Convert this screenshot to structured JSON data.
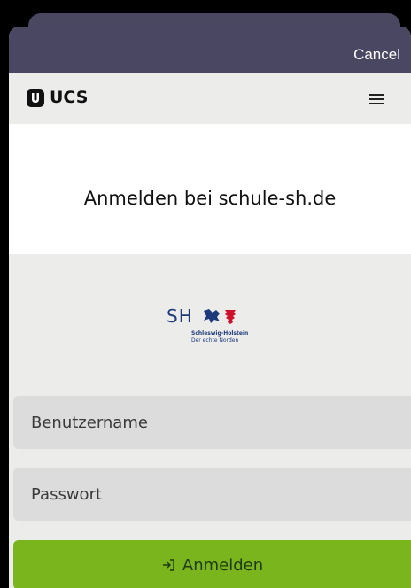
{
  "nav": {
    "cancel_label": "Cancel"
  },
  "header": {
    "brand": "UCS",
    "logo_icon": "ucs-logo-icon",
    "menu_icon": "hamburger-menu-icon"
  },
  "main": {
    "title": "Anmelden bei schule-sh.de"
  },
  "partner_logo": {
    "letters": "SH",
    "line1": "Schleswig-Holstein",
    "line2": "Der echte Norden"
  },
  "form": {
    "username_placeholder": "Benutzername",
    "password_placeholder": "Passwort",
    "submit_label": "Anmelden",
    "submit_icon": "login-arrow-icon"
  },
  "colors": {
    "nav_bg": "#4a4763",
    "panel_bg": "#ececeb",
    "input_bg": "#dcdcdc",
    "accent_green": "#7ab51d",
    "logo_blue": "#1f3a7a",
    "logo_red": "#d0112b"
  }
}
